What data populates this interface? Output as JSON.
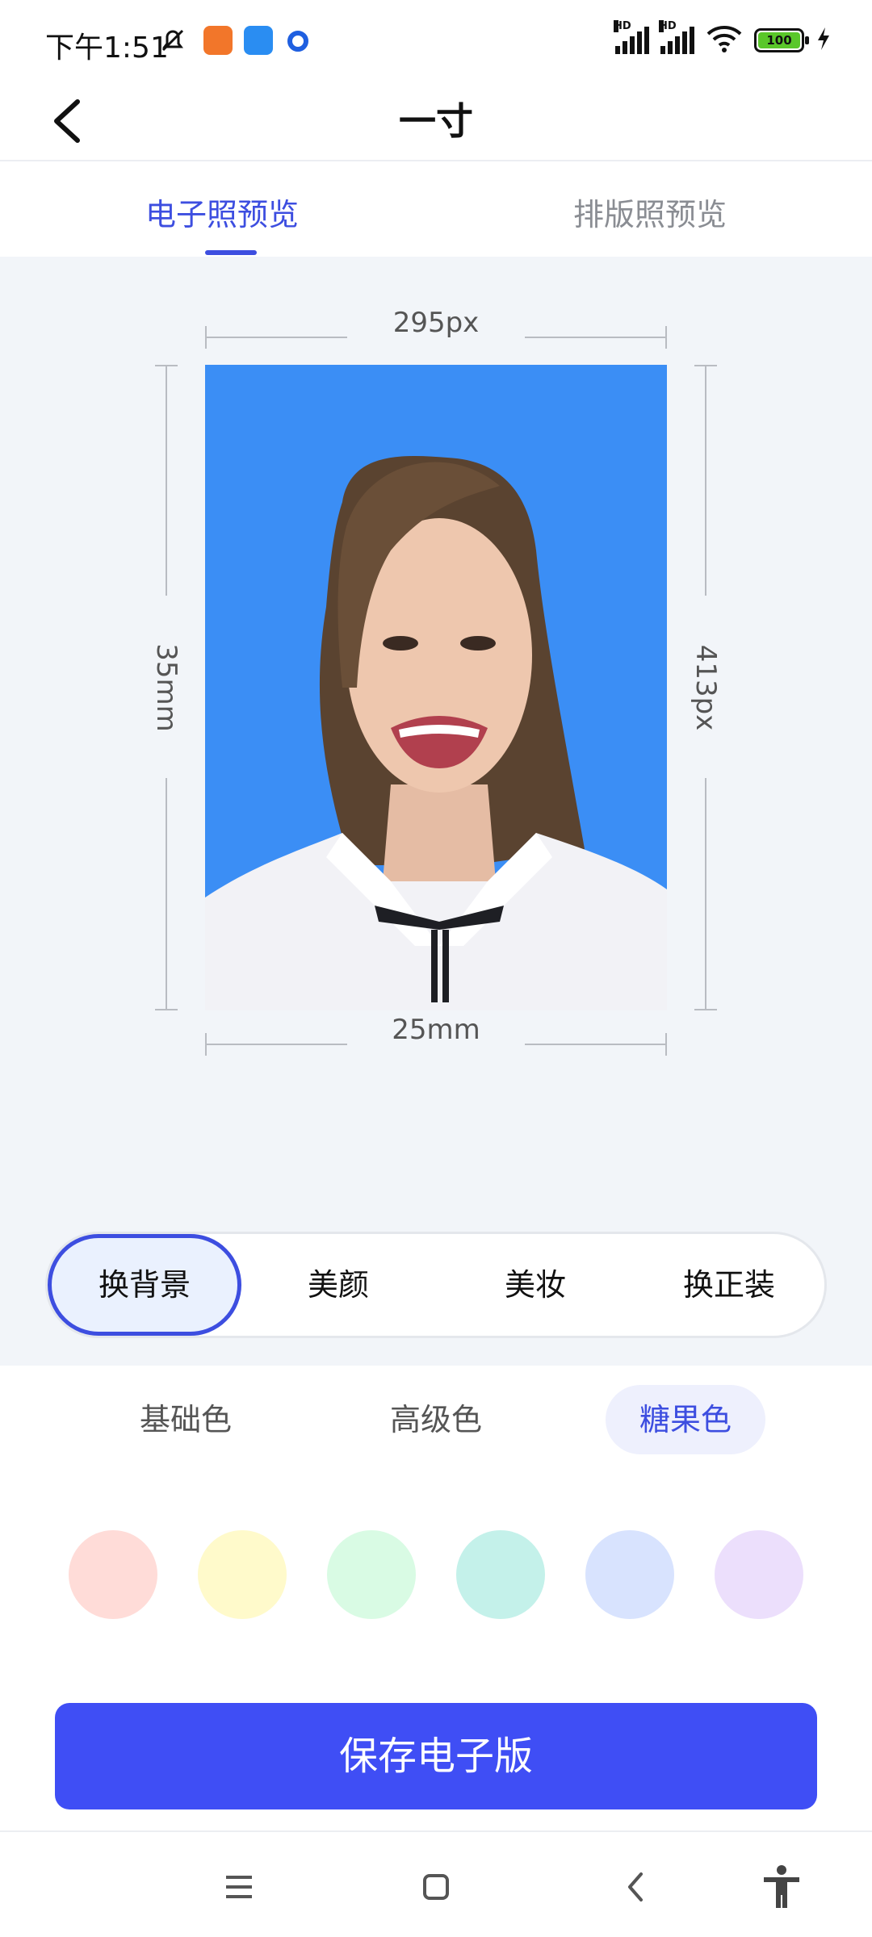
{
  "status_bar": {
    "time": "下午1:51",
    "battery": "100",
    "hd_label": "HD"
  },
  "header": {
    "title": "一寸"
  },
  "tabs": [
    {
      "label": "电子照预览",
      "active": true
    },
    {
      "label": "排版照预览",
      "active": false
    }
  ],
  "preview": {
    "width_px": "295px",
    "height_px": "413px",
    "height_mm": "35mm",
    "width_mm": "25mm",
    "background_color": "#3b8ef5"
  },
  "segments": [
    {
      "label": "换背景",
      "active": true
    },
    {
      "label": "美颜",
      "active": false
    },
    {
      "label": "美妆",
      "active": false
    },
    {
      "label": "换正装",
      "active": false
    }
  ],
  "color_categories": [
    {
      "label": "基础色",
      "active": false
    },
    {
      "label": "高级色",
      "active": false
    },
    {
      "label": "糖果色",
      "active": true
    }
  ],
  "swatches": [
    "#ffdcd8",
    "#fffacb",
    "#d9fbe4",
    "#c4f1ea",
    "#d8e3fe",
    "#ecdffc"
  ],
  "save_button": {
    "label": "保存电子版"
  },
  "colors": {
    "accent": "#3d4ee0",
    "button": "#3f4ef5"
  }
}
